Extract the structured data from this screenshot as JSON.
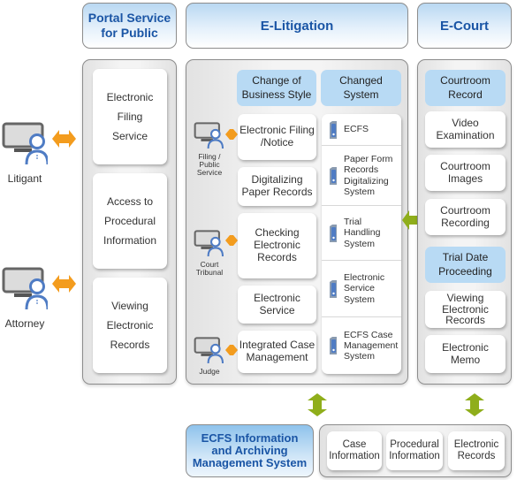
{
  "colors": {
    "header_text": "#1a55a5",
    "blue_card": "#b8daf4",
    "orange_arrow": "#f39c1e",
    "green_arrow": "#8fae1b",
    "person_blue": "#4f7cc4",
    "monitor_gray": "#666666"
  },
  "actors": [
    {
      "label": "Litigant",
      "icon": "user-computer-icon"
    },
    {
      "label": "Attorney",
      "icon": "user-computer-icon"
    }
  ],
  "portal": {
    "title": "Portal Service for Public",
    "title_line1": "Portal Service",
    "title_line2": "for Public",
    "services": [
      {
        "lines": [
          "Electronic",
          "Filing",
          "Service"
        ]
      },
      {
        "lines": [
          "Access to",
          "Procedural",
          "Information"
        ]
      },
      {
        "lines": [
          "Viewing",
          "Electronic",
          "Records"
        ]
      }
    ]
  },
  "elitigation": {
    "title": "E-Litigation",
    "col_business": "Change of Business Style",
    "col_business_lines": [
      "Change of",
      "Business Style"
    ],
    "col_system": "Changed System",
    "roles": [
      {
        "lines": [
          "Filing /",
          "Public",
          "Service"
        ]
      },
      {
        "lines": [
          "Court",
          "Tribunal"
        ]
      },
      {
        "lines": [
          "Judge"
        ]
      }
    ],
    "business": [
      {
        "lines": [
          "Electronic Filing",
          "/Notice"
        ]
      },
      {
        "lines": [
          "Digitalizing",
          "Paper Records"
        ]
      },
      {
        "lines": [
          "Checking",
          "Electronic",
          "Records"
        ]
      },
      {
        "lines": [
          "Electronic",
          "Service"
        ]
      },
      {
        "lines": [
          "Integrated Case",
          "Management"
        ]
      }
    ],
    "systems": [
      {
        "lines": [
          "ECFS"
        ]
      },
      {
        "lines": [
          "Paper Form",
          "Records",
          "Digitalizing",
          "System"
        ]
      },
      {
        "lines": [
          "Trial",
          "Handling",
          "System"
        ]
      },
      {
        "lines": [
          "Electronic",
          "Service",
          "System"
        ]
      },
      {
        "lines": [
          "ECFS Case",
          "Management",
          "System"
        ]
      }
    ]
  },
  "ecourt": {
    "title": "E-Court",
    "courtroom_record": [
      "Courtroom",
      "Record"
    ],
    "record_items": [
      {
        "lines": [
          "Video",
          "Examination"
        ]
      },
      {
        "lines": [
          "Courtroom",
          "Images"
        ]
      },
      {
        "lines": [
          "Courtroom",
          "Recording"
        ]
      }
    ],
    "trial_date": [
      "Trial Date",
      "Proceeding"
    ],
    "trial_items": [
      {
        "lines": [
          "Viewing",
          "Electronic",
          "Records"
        ]
      },
      {
        "lines": [
          "Electronic",
          "Memo"
        ]
      }
    ]
  },
  "archive": {
    "title_lines": [
      "ECFS Information",
      "and Archiving",
      "Management System"
    ],
    "items": [
      {
        "lines": [
          "Case",
          "Information"
        ]
      },
      {
        "lines": [
          "Procedural",
          "Information"
        ]
      },
      {
        "lines": [
          "Electronic",
          "Records"
        ]
      }
    ]
  }
}
